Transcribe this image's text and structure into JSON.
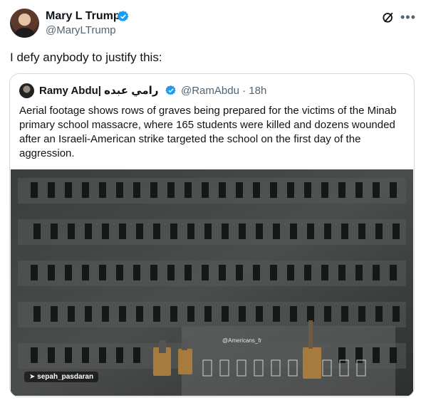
{
  "author": {
    "name": "Mary L Trump",
    "handle": "@MaryLTrump"
  },
  "tweet": {
    "text": "I defy anybody to justify this:"
  },
  "quoted": {
    "name": "Ramy Abdu| رامي عبده",
    "handle": "@RamAbdu",
    "time": "· 18h",
    "text": "Aerial footage shows rows of graves being prepared for the victims of the Minab primary school massacre, where 165 students were killed and dozens wounded after an Israeli-American strike targeted the school on the first day of the aggression.",
    "media": {
      "watermark_center": "@Americans_fr",
      "watermark_corner": "sepah_pasdaran"
    }
  },
  "icons": {
    "verified": "verified-badge-icon",
    "grok": "grok-icon",
    "more": "more-icon"
  },
  "colors": {
    "verified": "#1d9bf0",
    "text": "#0f1419",
    "secondary": "#536471"
  }
}
